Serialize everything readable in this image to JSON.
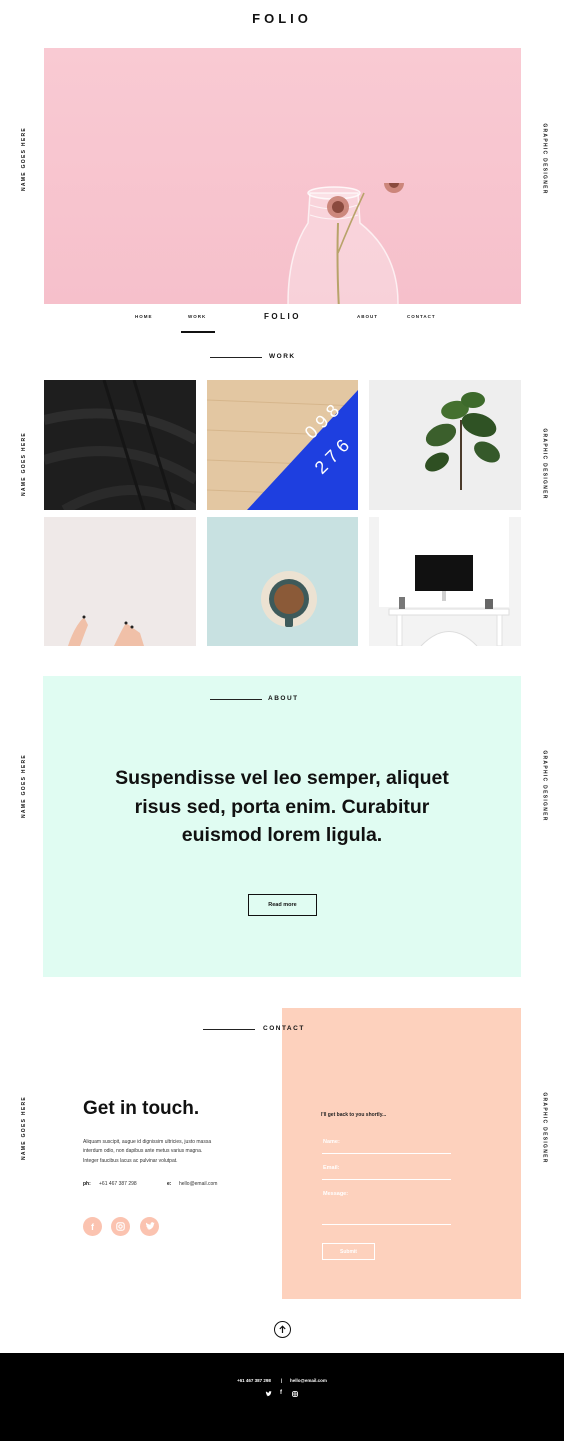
{
  "brand": "FOLIO",
  "side": {
    "left": "NAME GOES HERE",
    "right": "GRAPHIC DESIGNER"
  },
  "nav": {
    "items": [
      "HOME",
      "WORK",
      "ABOUT",
      "CONTACT"
    ],
    "logo": "FOLIO",
    "active": "WORK"
  },
  "work": {
    "heading": "WORK",
    "tiles": [
      "dark-spiral-staircase",
      "blue-numbers-card-on-wood",
      "fiddle-leaf-plant",
      "hand-nails",
      "coffee-cup",
      "desk-with-monitor"
    ]
  },
  "about": {
    "heading": "ABOUT",
    "quote_line1": "Suspendisse vel leo semper, aliquet",
    "quote_line2": "risus sed, porta enim. Curabitur",
    "quote_line3": "euismod lorem ligula.",
    "button": "Read more"
  },
  "contact": {
    "heading": "CONTACT",
    "title": "Get in touch.",
    "para_line1": "Aliquam suscipit, augue id dignissim ultricies, justo massa",
    "para_line2": "interdum odio, non dapibus ante metus varius magna.",
    "para_line3": "Integer faucibus lacus ac pulvinar volutpat.",
    "phone_label": "ph:",
    "phone": "+61 467 387 298",
    "email_label": "e:",
    "email": "hello@email.com",
    "social_icons": [
      "facebook-icon",
      "instagram-icon",
      "twitter-icon"
    ],
    "form": {
      "intro": "I'll get back to you shortly...",
      "name_label": "Name:",
      "email_label": "Email:",
      "message_label": "Message:",
      "submit": "Submit"
    }
  },
  "footer": {
    "phone": "+61 467 387 298",
    "separator": "|",
    "email": "hello@email.com",
    "icons": [
      "twitter-icon",
      "facebook-icon",
      "instagram-icon"
    ]
  },
  "colors": {
    "hero_pink": "#f7c5cf",
    "about_mint": "#e0fcf2",
    "contact_peach": "#fdd1bd",
    "footer_black": "#000000"
  }
}
